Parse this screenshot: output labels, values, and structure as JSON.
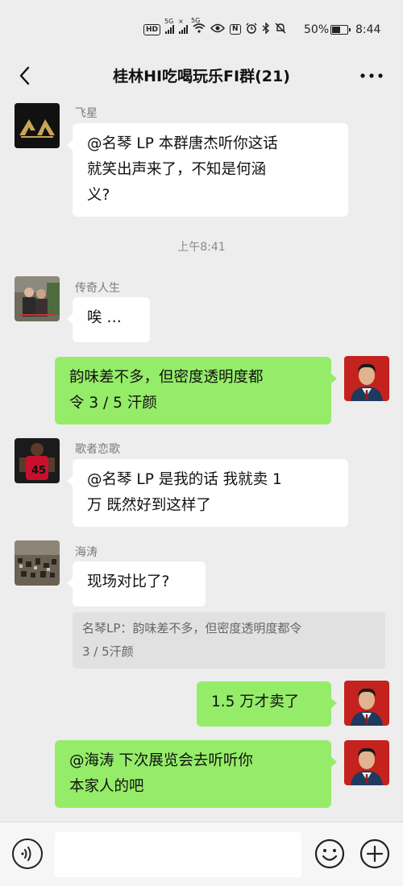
{
  "status_bar": {
    "hd_label": "HD",
    "network_1": "5G",
    "network_2": "5G",
    "nfc_label": "N",
    "battery_percent": "50%",
    "battery_level": 0.5,
    "time": "8:44"
  },
  "header": {
    "title": "桂林HI吃喝玩乐FI群(21)"
  },
  "chat": {
    "messages": [
      {
        "sender": "飞星",
        "text_line1": "@名琴 LP  本群唐杰听你这话",
        "text_line2": "就笑出声来了，不知是何涵",
        "text_line3": "义?"
      },
      {
        "timestamp": "上午8:41"
      },
      {
        "sender": "传奇人生",
        "text": "唉 …"
      },
      {
        "text_line1": "韵味差不多，但密度透明度都",
        "text_line2": "令 3 / 5 汗颜"
      },
      {
        "sender": "歌者恋歌",
        "text_line1": "@名琴 LP  是我的话 我就卖 1",
        "text_line2": "万 既然好到这样了"
      },
      {
        "sender": "海涛",
        "text": "现场对比了?",
        "quote_line1": "名琴LP：韵味差不多，但密度透明度都令",
        "quote_line2": "3 / 5汗颜"
      },
      {
        "text": "1.5 万才卖了"
      },
      {
        "text_line1": "@海涛    下次展览会去听听你",
        "text_line2": "本家人的吧"
      }
    ]
  },
  "input_bar": {
    "icons": [
      "voice-icon",
      "emoji-icon",
      "plus-icon"
    ]
  },
  "colors": {
    "background": "#ededed",
    "my_bubble": "#95ec69",
    "other_bubble": "#ffffff"
  }
}
